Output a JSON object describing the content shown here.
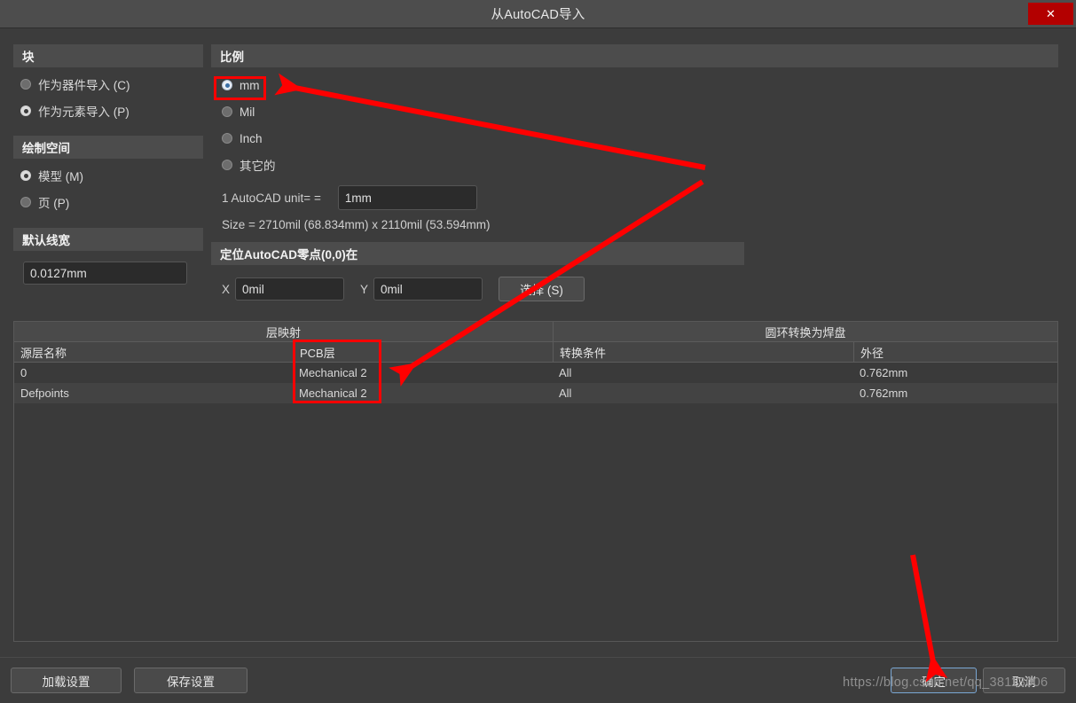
{
  "window": {
    "title": "从AutoCAD导入",
    "close_icon": "close-icon",
    "close_label": "✕"
  },
  "block_group": {
    "header": "块",
    "options": [
      {
        "label": "作为器件导入 (C)",
        "selected": false
      },
      {
        "label": "作为元素导入 (P)",
        "selected": true
      }
    ]
  },
  "drawing_space_group": {
    "header": "绘制空间",
    "options": [
      {
        "label": "模型 (M)",
        "selected": true
      },
      {
        "label": "页 (P)",
        "selected": false
      }
    ]
  },
  "default_width_group": {
    "header": "默认线宽",
    "value": "0.0127mm"
  },
  "scale_group": {
    "header": "比例",
    "options": [
      {
        "label": "mm",
        "selected": true
      },
      {
        "label": "Mil",
        "selected": false
      },
      {
        "label": "Inch",
        "selected": false
      },
      {
        "label": "其它的",
        "selected": false
      }
    ],
    "unit_label": "1 AutoCAD unit=  =",
    "unit_value": "1mm",
    "size_text": "Size =  2710mil (68.834mm) x 2110mil (53.594mm)"
  },
  "origin_group": {
    "header": "定位AutoCAD零点(0,0)在",
    "x_label": "X",
    "x_value": "0mil",
    "y_label": "Y",
    "y_value": "0mil",
    "select_button": "选择 (S)"
  },
  "table": {
    "top_headers": [
      "层映射",
      "圆环转换为焊盘"
    ],
    "columns": [
      "源层名称",
      "PCB层",
      "转换条件",
      "外径"
    ],
    "rows": [
      {
        "source": "0",
        "pcb": "Mechanical 2",
        "cond": "All",
        "dia": "0.762mm"
      },
      {
        "source": "Defpoints",
        "pcb": "Mechanical 2",
        "cond": "All",
        "dia": "0.762mm"
      }
    ]
  },
  "footer": {
    "load_settings": "加载设置",
    "save_settings": "保存设置",
    "ok": "确定",
    "cancel": "取消"
  },
  "watermark": "https://blog.csdn.net/qq_38113006",
  "colors": {
    "accent_red": "#ff0000",
    "close_red": "#b30000",
    "focus_blue": "#7aa7d4",
    "window_bg": "#3c3c3c"
  }
}
